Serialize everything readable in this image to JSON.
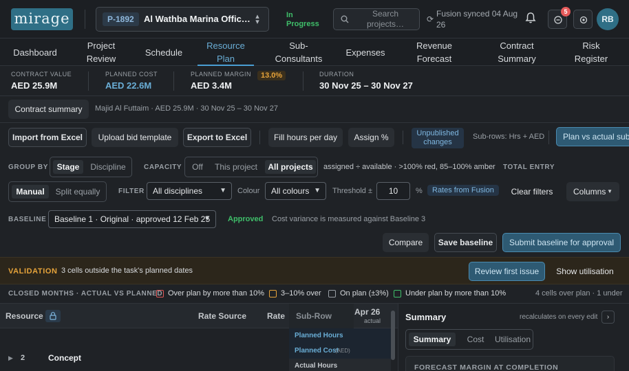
{
  "brand": {
    "logo": "mirage"
  },
  "project": {
    "code": "P-1892",
    "name": "Al Wathba Marina Offic…",
    "status": "In Progress"
  },
  "search": {
    "placeholder": "Search projects…"
  },
  "sync": {
    "text": "Fusion synced 04 Aug 26"
  },
  "notifications": {
    "count": "5"
  },
  "user": {
    "initials": "RB"
  },
  "tabs": [
    {
      "label": "Dashboard"
    },
    {
      "label": "Project Review"
    },
    {
      "label": "Schedule"
    },
    {
      "label": "Resource Plan"
    },
    {
      "label": "Sub-Consultants"
    },
    {
      "label": "Expenses"
    },
    {
      "label": "Revenue Forecast"
    },
    {
      "label": "Contract Summary"
    },
    {
      "label": "Risk Register"
    }
  ],
  "metrics": {
    "contract_value": {
      "label": "CONTRACT VALUE",
      "value": "AED 25.9M"
    },
    "planned_cost": {
      "label": "PLANNED COST",
      "value": "AED 22.6M"
    },
    "planned_margin": {
      "label": "PLANNED MARGIN",
      "value": "AED 3.4M",
      "pct": "13.0%"
    },
    "duration": {
      "label": "DURATION",
      "value": "30 Nov 25 – 30 Nov 27"
    }
  },
  "context": {
    "button": "Contract summary",
    "text": "Majid Al Futtaim · AED 25.9M · 30 Nov 25 – 30 Nov 27"
  },
  "toolbar": {
    "import": "Import from Excel",
    "upload": "Upload bid template",
    "export": "Export to Excel",
    "fill": "Fill hours per day",
    "assign": "Assign %",
    "unpublished": "Unpublished changes",
    "subrows": "Sub-rows: Hrs + AED",
    "plan_vs_actual": "Plan vs actual sub"
  },
  "grouping": {
    "group_by_label": "GROUP BY",
    "group_by": [
      "Stage",
      "Discipline"
    ],
    "capacity_label": "CAPACITY",
    "capacity": [
      "Off",
      "This project",
      "All projects"
    ],
    "capacity_hint": "assigned ÷ available · >100% red, 85–100% amber",
    "total_entry_label": "TOTAL ENTRY"
  },
  "entry": {
    "modes": [
      "Manual",
      "Split equally"
    ],
    "filter_label": "FILTER",
    "discipline": "All disciplines",
    "colour_label": "Colour",
    "colour": "All colours",
    "threshold_label": "Threshold ±",
    "threshold": "10",
    "threshold_unit": "%",
    "rates": "Rates from Fusion",
    "clear": "Clear filters",
    "columns": "Columns"
  },
  "baseline": {
    "label": "BASELINE",
    "value": "Baseline 1 · Original · approved 12 Feb 25",
    "status": "Approved",
    "note": "Cost variance is measured against Baseline 3",
    "compare": "Compare",
    "save": "Save baseline",
    "submit": "Submit baseline for approval"
  },
  "validation": {
    "label": "VALIDATION",
    "message": "3 cells outside the task's planned dates",
    "review": "Review first issue",
    "show_util": "Show utilisation"
  },
  "legend": {
    "title": "CLOSED MONTHS · ACTUAL VS PLANNED",
    "items": [
      "Over plan by more than 10%",
      "3–10% over",
      "On plan (±3%)",
      "Under plan by more than 10%"
    ],
    "colors": [
      "#e05a5a",
      "#e6a33a",
      "#9aa0a6",
      "#3fbf6a"
    ],
    "summary": "4 cells over plan · 1 under"
  },
  "grid": {
    "headers": {
      "resource": "Resource",
      "rate_source": "Rate Source",
      "rate": "Rate",
      "subrow": "Sub-Row",
      "month": "Apr 26",
      "month_sub": "actual"
    },
    "row": {
      "num": "2",
      "name": "Concept"
    },
    "subrows": [
      "Planned Hours",
      "Planned Cost",
      "(AED)",
      "Actual Hours"
    ]
  },
  "summary": {
    "title": "Summary",
    "hint": "recalculates on every edit",
    "tabs": [
      "Summary",
      "Cost",
      "Utilisation"
    ],
    "card_title": "FORECAST MARGIN AT COMPLETION"
  }
}
